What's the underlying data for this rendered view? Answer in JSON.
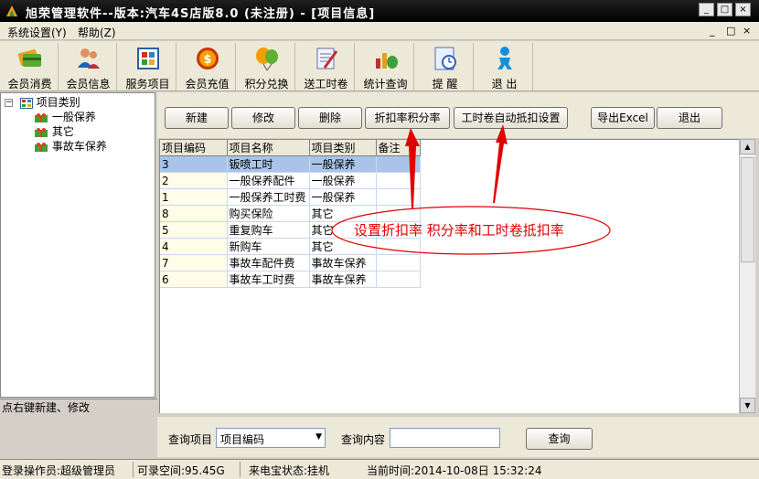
{
  "window": {
    "title": "旭荣管理软件--版本:汽车4S店版8.0 (未注册) - [项目信息]",
    "minimize": "_",
    "maximize": "□",
    "close": "×"
  },
  "menu": {
    "items": [
      "系统设置(Y)",
      "帮助(Z)"
    ],
    "mdi": [
      "_",
      "□",
      "×"
    ]
  },
  "toolbar": {
    "tools": [
      {
        "label": "会员消费",
        "icon": "card-icon"
      },
      {
        "label": "会员信息",
        "icon": "users-icon"
      },
      {
        "label": "服务项目",
        "icon": "grid-icon"
      },
      {
        "label": "会员充值",
        "icon": "coin-icon"
      },
      {
        "label": "积分兑换",
        "icon": "balloon-icon"
      },
      {
        "label": "送工时卷",
        "icon": "pen-note-icon"
      },
      {
        "label": "统计查询",
        "icon": "chart-bucket-icon"
      },
      {
        "label": "提  醒",
        "icon": "clock-icon"
      },
      {
        "label": "退  出",
        "icon": "exit-person-icon"
      }
    ]
  },
  "tree": {
    "root": "项目类别",
    "children": [
      "一般保养",
      "其它",
      "事故车保养"
    ],
    "hint": "点右键新建、修改"
  },
  "actions": {
    "new": "新建",
    "edit": "修改",
    "delete": "删除",
    "discount": "折扣率积分率",
    "auto_deduct": "工时卷自动抵扣设置",
    "export": "导出Excel",
    "exit": "退出"
  },
  "table": {
    "columns": [
      "项目编码",
      "项目名称",
      "项目类别",
      "备注"
    ],
    "rows": [
      [
        "3",
        "钣喷工时",
        "一般保养",
        ""
      ],
      [
        "2",
        "一般保养配件",
        "一般保养",
        ""
      ],
      [
        "1",
        "一般保养工时费",
        "一般保养",
        ""
      ],
      [
        "8",
        "购买保险",
        "其它",
        ""
      ],
      [
        "5",
        "重复购车",
        "其它",
        ""
      ],
      [
        "4",
        "新购车",
        "其它",
        ""
      ],
      [
        "7",
        "事故车配件费",
        "事故车保养",
        ""
      ],
      [
        "6",
        "事故车工时费",
        "事故车保养",
        ""
      ]
    ],
    "selected_row": 0
  },
  "annotation": {
    "text": "设置折扣率 积分率和工时卷抵扣率"
  },
  "search": {
    "field_label": "查询项目",
    "field_value": "项目编码",
    "content_label": "查询内容",
    "content_value": "",
    "button": "查询"
  },
  "status": {
    "operator": "登录操作员:超级管理员",
    "space": "可录空间:95.45G",
    "call": "来电宝状态:挂机",
    "time": "当前时间:2014-10-08日  15:32:24"
  },
  "colors": {
    "annotation": "#e00000",
    "selection": "#a9c4e8"
  }
}
